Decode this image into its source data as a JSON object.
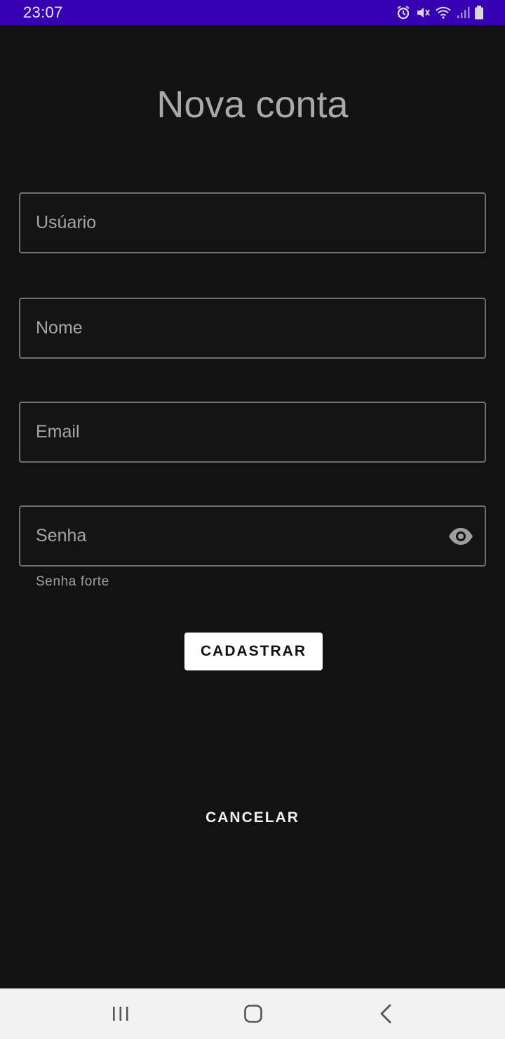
{
  "status_bar": {
    "time": "23:07",
    "background": "#3700b3",
    "icons": [
      "alarm-icon",
      "mute-icon",
      "wifi-icon",
      "signal-icon",
      "battery-icon"
    ]
  },
  "screen": {
    "title": "Nova conta",
    "background": "#121212"
  },
  "form": {
    "usuario": {
      "placeholder": "Usúario",
      "value": ""
    },
    "nome": {
      "placeholder": "Nome",
      "value": ""
    },
    "email": {
      "placeholder": "Email",
      "value": ""
    },
    "senha": {
      "placeholder": "Senha",
      "value": "",
      "toggle_icon": "eye-icon",
      "helper": "Senha forte"
    }
  },
  "actions": {
    "submit_label": "CADASTRAR",
    "cancel_label": "CANCELAR"
  },
  "nav_bar": {
    "icons": [
      "recent-apps-icon",
      "home-icon",
      "back-icon"
    ]
  }
}
